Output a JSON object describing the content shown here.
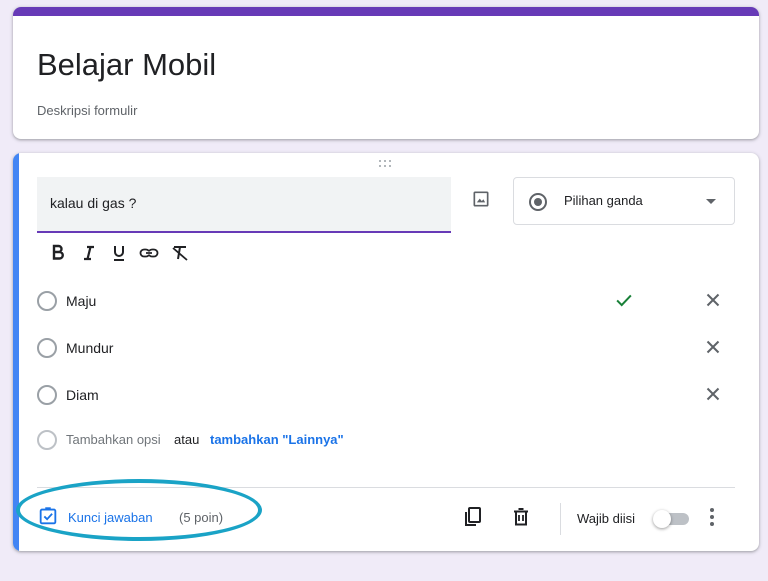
{
  "form": {
    "title": "Belajar Mobil",
    "description": "Deskripsi formulir"
  },
  "question": {
    "text": "kalau di gas ?",
    "type": "Pilihan ganda",
    "options": [
      {
        "label": "Maju",
        "correct": true
      },
      {
        "label": "Mundur",
        "correct": false
      },
      {
        "label": "Diam",
        "correct": false
      }
    ],
    "add_option": "Tambahkan opsi",
    "or": "atau",
    "add_other": "tambahkan \"Lainnya\""
  },
  "footer": {
    "answer_key": "Kunci jawaban",
    "points": "(5 poin)",
    "required": "Wajib diisi",
    "required_on": false
  },
  "icons": {
    "image": "image-icon",
    "type_radio": "radio-checked-icon",
    "bold": "bold-icon",
    "italic": "italic-icon",
    "underline": "underline-icon",
    "link": "link-icon",
    "clear_format": "clear-format-icon",
    "correct": "check-icon",
    "remove": "close-icon",
    "answer_key": "answer-key-icon",
    "duplicate": "duplicate-icon",
    "delete": "delete-icon",
    "more": "more-vert-icon"
  },
  "colors": {
    "background": "#f0ebf8",
    "theme": "#673ab7",
    "active_bar": "#4285f4",
    "link": "#1a73e8",
    "correct": "#188038",
    "highlight": "#1aa3c6"
  }
}
